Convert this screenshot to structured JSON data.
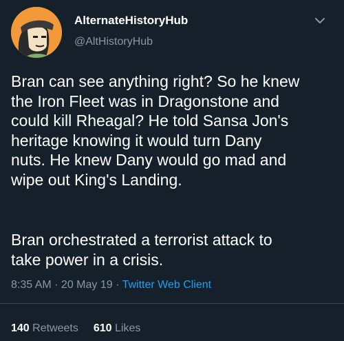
{
  "author": {
    "display_name": "AlternateHistoryHub",
    "handle": "@AltHistoryHub",
    "avatar": "cartoon-character-avatar"
  },
  "tweet": {
    "lines": [
      "Bran can see anything right? So he knew",
      "the Iron Fleet was in Dragonstone and",
      "could kill Rheagal? He told Sansa Jon's",
      "heritage knowing it would turn Dany",
      "nuts. He knew Dany would go mad and",
      "wipe out King's Landing."
    ],
    "lines2": [
      "Bran orchestrated a terrorist attack to",
      "take power in a crisis."
    ]
  },
  "meta": {
    "time": "8:35 AM",
    "sep1": " · ",
    "date": "20 May 19",
    "sep2": " · ",
    "client": "Twitter Web Client"
  },
  "stats": {
    "retweets_count": "140",
    "retweets_label": "Retweets",
    "likes_count": "610",
    "likes_label": "Likes"
  },
  "icons": {
    "menu": "chevron-down-icon"
  },
  "colors": {
    "background": "#15202b",
    "text": "#ffffff",
    "secondary": "#8899a6",
    "link": "#1da1f2",
    "divider": "#38444d"
  }
}
